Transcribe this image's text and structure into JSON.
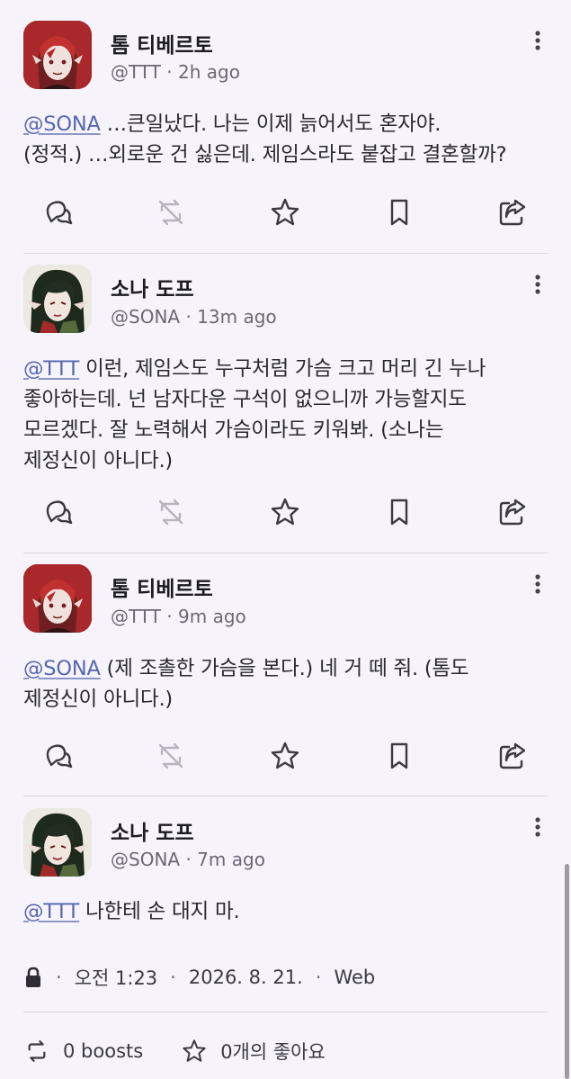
{
  "posts": [
    {
      "display_name": "톰 티베르토",
      "handle": "@TTT",
      "time": "2h ago",
      "mention": "@SONA",
      "lines": [
        " …큰일났다. 나는 이제 늙어서도 혼자야.",
        "(정적.) …외로운 건 싫은데. 제임스라도 붙잡고 결혼할까?"
      ]
    },
    {
      "display_name": "소나 도프",
      "handle": "@SONA",
      "time": "13m ago",
      "mention": "@TTT",
      "lines": [
        " 이런, 제임스도 누구처럼 가슴 크고 머리 긴 누나",
        "좋아하는데. 넌 남자다운 구석이 없으니까 가능할지도",
        "모르겠다. 잘 노력해서 가슴이라도 키워봐. (소나는",
        "제정신이 아니다.)"
      ]
    },
    {
      "display_name": "톰 티베르토",
      "handle": "@TTT",
      "time": "9m ago",
      "mention": "@SONA",
      "lines": [
        " (제 조촐한 가슴을 본다.) 네 거 떼 줘. (톰도",
        "제정신이 아니다.)"
      ]
    },
    {
      "display_name": "소나 도프",
      "handle": "@SONA",
      "time": "7m ago",
      "mention": "@TTT",
      "lines": [
        " 나한테 손 대지 마."
      ]
    }
  ],
  "detail": {
    "time": "오전 1:23",
    "date": "2026. 8. 21.",
    "source": "Web",
    "boosts": "0 boosts",
    "likes": "0개의 좋아요"
  },
  "colors": {
    "background": "#f6f4fa",
    "mention": "#5567b0",
    "text": "#1c1b22",
    "secondary": "#6b6875"
  }
}
